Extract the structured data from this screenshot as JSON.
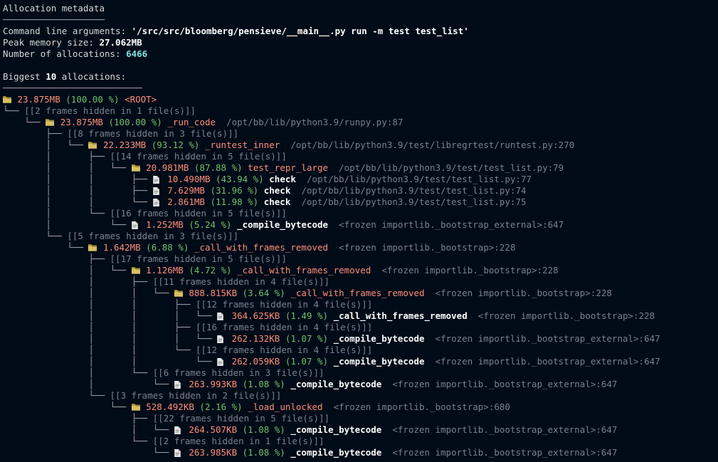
{
  "header": {
    "title": "Allocation metadata",
    "divider1_len": 19,
    "cmd_label": "Command line arguments: ",
    "cmd_value": "'/src/src/bloomberg/pensieve/__main__.py run -m test test_list'",
    "peak_label": "Peak memory size: ",
    "peak_value": "27.062MB",
    "alloc_label": "Number of allocations: ",
    "alloc_value": "6466",
    "biggest_prefix": "Biggest ",
    "biggest_n": "10",
    "biggest_suffix": " allocations:",
    "divider2_len": 26
  },
  "tree": [
    {
      "type": "root",
      "prefix": "📂 ",
      "size": "23.875MB",
      "pct": "(100.00 %)",
      "name": "<ROOT>"
    },
    {
      "type": "hidden",
      "prefix": "└── ",
      "text": "[[2 frames hidden in 1 file(s)]]"
    },
    {
      "type": "folder",
      "prefix": "    └── 📂 ",
      "size": "23.875MB",
      "pct": "(100.00 %)",
      "func": "_run_code",
      "loc": "/opt/bb/lib/python3.9/runpy.py:87"
    },
    {
      "type": "hidden",
      "prefix": "        ├── ",
      "text": "[[8 frames hidden in 3 file(s)]]"
    },
    {
      "type": "folder",
      "prefix": "        │   └── 📂 ",
      "size": "22.233MB",
      "pct": "(93.12 %)",
      "func": "_runtest_inner",
      "loc": "/opt/bb/lib/python3.9/test/libregrtest/runtest.py:270"
    },
    {
      "type": "hidden",
      "prefix": "        │       ├── ",
      "text": "[[14 frames hidden in 5 file(s)]]"
    },
    {
      "type": "folder",
      "prefix": "        │       │   └── 📂 ",
      "size": "20.981MB",
      "pct": "(87.88 %)",
      "func": "test_repr_large",
      "loc": "/opt/bb/lib/python3.9/test/test_list.py:79"
    },
    {
      "type": "file",
      "prefix": "        │       │       ├── 📄 ",
      "size": "10.490MB",
      "pct": "(43.94 %)",
      "func": "check",
      "loc": "/opt/bb/lib/python3.9/test/test_list.py:77"
    },
    {
      "type": "file",
      "prefix": "        │       │       ├── 📄 ",
      "size": "7.629MB",
      "pct": "(31.96 %)",
      "func": "check",
      "loc": "/opt/bb/lib/python3.9/test/test_list.py:74"
    },
    {
      "type": "file",
      "prefix": "        │       │       └── 📄 ",
      "size": "2.861MB",
      "pct": "(11.98 %)",
      "func": "check",
      "loc": "/opt/bb/lib/python3.9/test/test_list.py:75"
    },
    {
      "type": "hidden",
      "prefix": "        │       └── ",
      "text": "[[16 frames hidden in 5 file(s)]]"
    },
    {
      "type": "file",
      "prefix": "        │           └── 📄 ",
      "size": "1.252MB",
      "pct": "(5.24 %)",
      "func": "_compile_bytecode",
      "loc": "<frozen importlib._bootstrap_external>:647"
    },
    {
      "type": "hidden",
      "prefix": "        └── ",
      "text": "[[5 frames hidden in 3 file(s)]]"
    },
    {
      "type": "folder",
      "prefix": "            └── 📂 ",
      "size": "1.642MB",
      "pct": "(6.88 %)",
      "func": "_call_with_frames_removed",
      "loc": "<frozen importlib._bootstrap>:228"
    },
    {
      "type": "hidden",
      "prefix": "                ├── ",
      "text": "[[17 frames hidden in 5 file(s)]]"
    },
    {
      "type": "folder",
      "prefix": "                │   └── 📂 ",
      "size": "1.126MB",
      "pct": "(4.72 %)",
      "func": "_call_with_frames_removed",
      "loc": "<frozen importlib._bootstrap>:228"
    },
    {
      "type": "hidden",
      "prefix": "                │       ├── ",
      "text": "[[11 frames hidden in 4 file(s)]]"
    },
    {
      "type": "folder",
      "prefix": "                │       │   └── 📂 ",
      "size": "888.815KB",
      "pct": "(3.64 %)",
      "func": "_call_with_frames_removed",
      "loc": "<frozen importlib._bootstrap>:228"
    },
    {
      "type": "hidden",
      "prefix": "                │       │       ├── ",
      "text": "[[12 frames hidden in 4 file(s)]]"
    },
    {
      "type": "file",
      "prefix": "                │       │       │   └── 📄 ",
      "size": "364.625KB",
      "pct": "(1.49 %)",
      "func": "_call_with_frames_removed",
      "loc": "<frozen importlib._bootstrap>:228"
    },
    {
      "type": "hidden",
      "prefix": "                │       │       ├── ",
      "text": "[[16 frames hidden in 4 file(s)]]"
    },
    {
      "type": "file",
      "prefix": "                │       │       │   └── 📄 ",
      "size": "262.132KB",
      "pct": "(1.07 %)",
      "func": "_compile_bytecode",
      "loc": "<frozen importlib._bootstrap_external>:647"
    },
    {
      "type": "hidden",
      "prefix": "                │       │       └── ",
      "text": "[[12 frames hidden in 4 file(s)]]"
    },
    {
      "type": "file",
      "prefix": "                │       │           └── 📄 ",
      "size": "262.059KB",
      "pct": "(1.07 %)",
      "func": "_compile_bytecode",
      "loc": "<frozen importlib._bootstrap_external>:647"
    },
    {
      "type": "hidden",
      "prefix": "                │       └── ",
      "text": "[[6 frames hidden in 3 file(s)]]"
    },
    {
      "type": "file",
      "prefix": "                │           └── 📄 ",
      "size": "263.993KB",
      "pct": "(1.08 %)",
      "func": "_compile_bytecode",
      "loc": "<frozen importlib._bootstrap_external>:647"
    },
    {
      "type": "hidden",
      "prefix": "                └── ",
      "text": "[[3 frames hidden in 2 file(s)]]"
    },
    {
      "type": "folder",
      "prefix": "                    └── 📂 ",
      "size": "528.492KB",
      "pct": "(2.16 %)",
      "func": "_load_unlocked",
      "loc": "<frozen importlib._bootstrap>:680"
    },
    {
      "type": "hidden",
      "prefix": "                        ├── ",
      "text": "[[22 frames hidden in 5 file(s)]]"
    },
    {
      "type": "file",
      "prefix": "                        │   └── 📄 ",
      "size": "264.507KB",
      "pct": "(1.08 %)",
      "func": "_compile_bytecode",
      "loc": "<frozen importlib._bootstrap_external>:647"
    },
    {
      "type": "hidden",
      "prefix": "                        └── ",
      "text": "[[2 frames hidden in 1 file(s)]]"
    },
    {
      "type": "file",
      "prefix": "                            └── 📄 ",
      "size": "263.985KB",
      "pct": "(1.08 %)",
      "func": "_compile_bytecode",
      "loc": "<frozen importlib._bootstrap_external>:647"
    }
  ]
}
